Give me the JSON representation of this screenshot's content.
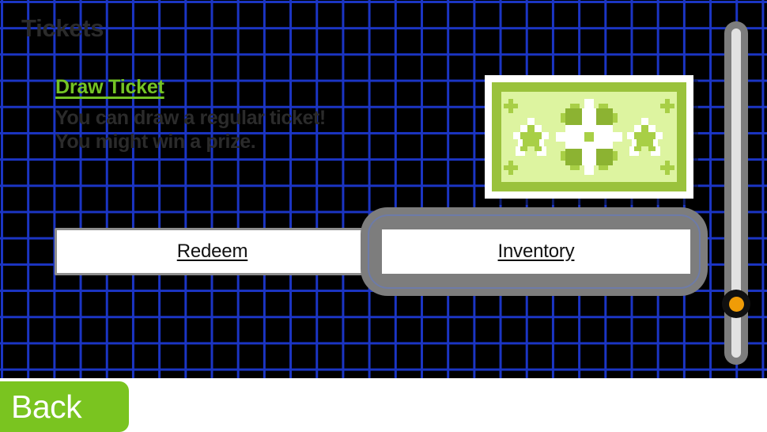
{
  "screen": {
    "title": "Tickets",
    "background_color": "#000000",
    "grid_line_color": "#1b35c4",
    "bottom_bar_color": "#ffffff"
  },
  "item": {
    "link_label": "Draw Ticket",
    "link_color": "#74c424",
    "description": "You can draw a regular ticket! You might win a prize.",
    "description_color": "#2b2b2b"
  },
  "ticket_art": {
    "name": "regular-ticket",
    "frame_color": "#ffffff",
    "border_color": "#9ac23c",
    "fill_color": "#ddf4a0",
    "accent_color": "#a8cf46",
    "shade_color": "#8cb332",
    "sparkle_color": "#ffffff"
  },
  "buttons": {
    "redeem_label": "Redeem",
    "inventory_label": "Inventory",
    "back_label": "Back",
    "back_color": "#7ac420",
    "focused": "inventory"
  },
  "scrollbar": {
    "orientation": "vertical",
    "thumb_color": "#f09c07",
    "thumb_ring_color": "#101010",
    "track_color": "#e2e2e2",
    "frame_color": "#7d7d7d",
    "position_percent": 81
  }
}
